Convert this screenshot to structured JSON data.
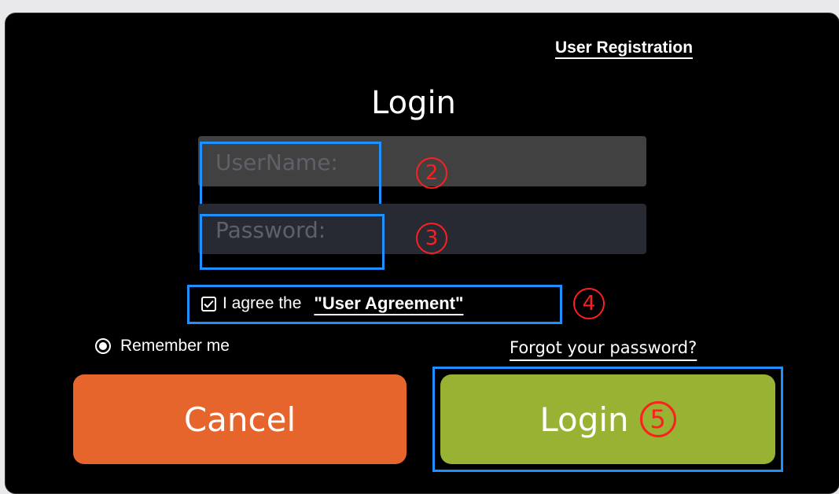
{
  "dialog": {
    "registration_link": "User Registration",
    "title": "Login",
    "username_placeholder": "UserName:",
    "password_placeholder": "Password:",
    "agree_text": "I agree the",
    "agreement_link": "\"User Agreement\"",
    "remember_label": "Remember me",
    "forgot_link": "Forgot your password?",
    "cancel_label": "Cancel",
    "login_label": "Login"
  },
  "annotations": {
    "badge_2": "2",
    "badge_3": "3",
    "badge_4": "4",
    "badge_5": "5"
  },
  "state": {
    "agree_checked": true,
    "remember_selected": true
  },
  "colors": {
    "cancel": "#e5652c",
    "login": "#98b234",
    "highlight": "#1e90ff",
    "badge": "#ff1f1f"
  }
}
